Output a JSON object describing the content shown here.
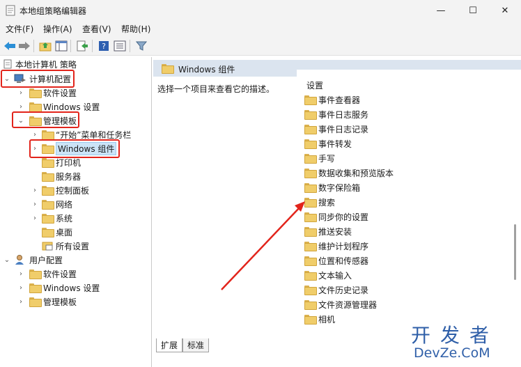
{
  "window": {
    "title": "本地组策略编辑器",
    "minimize": "—",
    "maximize": "☐",
    "close": "✕"
  },
  "menu": [
    "文件(F)",
    "操作(A)",
    "查看(V)",
    "帮助(H)"
  ],
  "toolbar": {
    "icons": [
      "back-icon",
      "forward-icon",
      "up-folder-icon",
      "show-tree-icon",
      "export-icon",
      "help-icon",
      "properties-icon",
      "filter-icon"
    ]
  },
  "tree": {
    "root": "本地计算机 策略",
    "computer_config": "计算机配置",
    "cc_software": "软件设置",
    "cc_windows": "Windows 设置",
    "cc_admin": "管理模板",
    "start_menu": "“开始”菜单和任务栏",
    "windows_components": "Windows 组件",
    "printers": "打印机",
    "servers": "服务器",
    "control_panel": "控制面板",
    "network": "网络",
    "system": "系统",
    "desktop": "桌面",
    "all_settings": "所有设置",
    "user_config": "用户配置",
    "uc_software": "软件设置",
    "uc_windows": "Windows 设置",
    "uc_admin": "管理模板"
  },
  "details": {
    "header": "Windows 组件",
    "description": "选择一个项目来查看它的描述。",
    "column": "设置",
    "items": [
      "事件查看器",
      "事件日志服务",
      "事件日志记录",
      "事件转发",
      "手写",
      "数据收集和预览版本",
      "数字保险箱",
      "搜索",
      "同步你的设置",
      "推送安装",
      "维护计划程序",
      "位置和传感器",
      "文本输入",
      "文件历史记录",
      "文件资源管理器",
      "相机"
    ]
  },
  "tabs": {
    "extended": "扩展",
    "standard": "标准"
  },
  "watermark": {
    "big": "开发者",
    "small": "DevZe.CoM"
  },
  "colors": {
    "highlight": "#e2241b",
    "arrow": "#e2241b",
    "folder": "#f0cd6a"
  }
}
